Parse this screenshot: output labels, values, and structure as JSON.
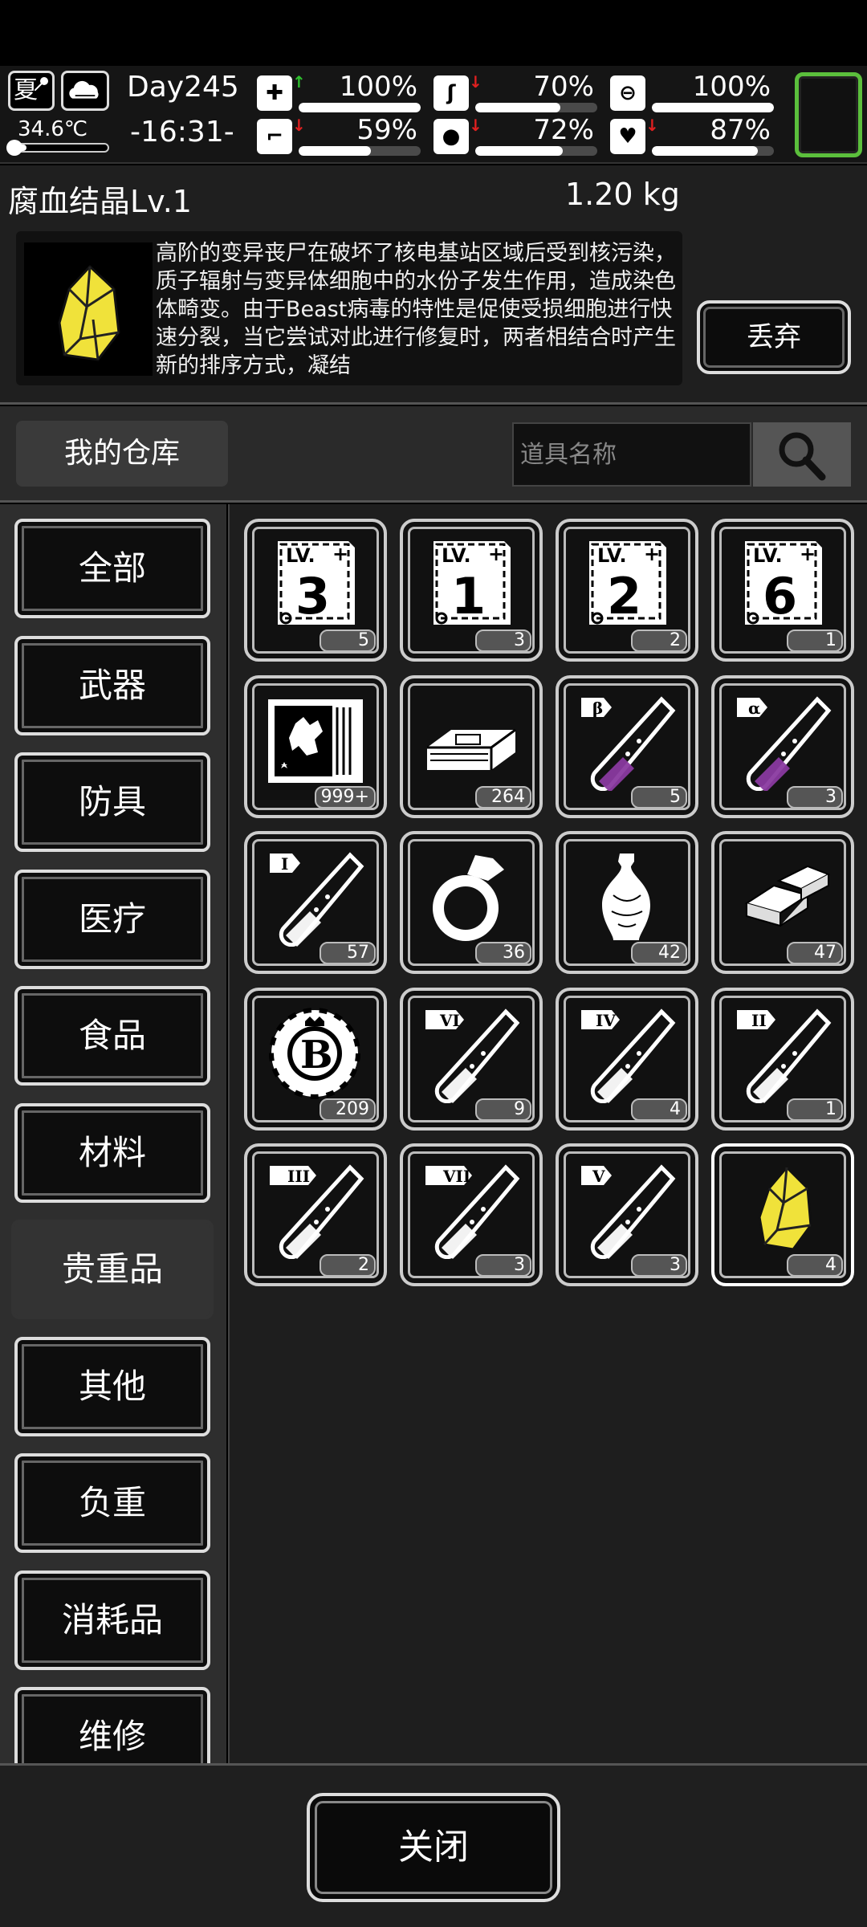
{
  "status": {
    "season": "夏",
    "temperature": "34.6℃",
    "day": "Day245",
    "time": "-16:31-",
    "stats": [
      {
        "id": "health",
        "icon": "medkit-icon",
        "arrow": "up",
        "value": "100%",
        "level": 1.0
      },
      {
        "id": "hunger",
        "icon": "stomach-icon",
        "arrow": "down",
        "value": "70%",
        "level": 0.7
      },
      {
        "id": "energy",
        "icon": "canteen-icon",
        "arrow": "none",
        "value": "100%",
        "level": 1.0
      },
      {
        "id": "stamina",
        "icon": "boot-icon",
        "arrow": "down",
        "value": "59%",
        "level": 0.59
      },
      {
        "id": "thirst",
        "icon": "water-drop-icon",
        "arrow": "down",
        "value": "72%",
        "level": 0.72
      },
      {
        "id": "mood",
        "icon": "heart-icon",
        "arrow": "down",
        "value": "87%",
        "level": 0.87
      }
    ],
    "accent_color": "#5bbf3c"
  },
  "detail": {
    "name": "腐血结晶Lv.1",
    "weight": "1.20 kg",
    "description": "高阶的变异丧尸在破坏了核电基站区域后受到核污染，质子辐射与变异体细胞中的水份子发生作用，造成染色体畸变。由于Beast病毒的特性是促使受损细胞进行快速分裂，当它尝试对此进行修复时，两者相结合时产生新的排序方式，凝结",
    "discard_label": "丢弃",
    "icon": "yellow-crystal-icon"
  },
  "search": {
    "warehouse_label": "我的仓库",
    "placeholder": "道具名称"
  },
  "categories": [
    "全部",
    "武器",
    "防具",
    "医疗",
    "食品",
    "材料",
    "贵重品",
    "其他",
    "负重",
    "消耗品",
    "维修"
  ],
  "active_category": "贵重品",
  "items": [
    {
      "icon": "blueprint-lv3-icon",
      "label": "3",
      "qty": "5"
    },
    {
      "icon": "blueprint-lv1-icon",
      "label": "1",
      "qty": "3"
    },
    {
      "icon": "blueprint-lv2-icon",
      "label": "2",
      "qty": "2"
    },
    {
      "icon": "blueprint-lv6-icon",
      "label": "6",
      "qty": "1"
    },
    {
      "icon": "mutant-research-card-icon",
      "label": "",
      "qty": "999+"
    },
    {
      "icon": "cash-bundle-icon",
      "label": "",
      "qty": "264"
    },
    {
      "icon": "beta-test-tube-icon",
      "label": "β",
      "qty": "5"
    },
    {
      "icon": "alpha-test-tube-icon",
      "label": "α",
      "qty": "3"
    },
    {
      "icon": "test-tube-i-icon",
      "label": "I",
      "qty": "57"
    },
    {
      "icon": "diamond-ring-icon",
      "label": "",
      "qty": "36"
    },
    {
      "icon": "porcelain-vase-icon",
      "label": "",
      "qty": "42"
    },
    {
      "icon": "gold-bars-icon",
      "label": "",
      "qty": "47"
    },
    {
      "icon": "bitcoin-chip-icon",
      "label": "B",
      "qty": "209"
    },
    {
      "icon": "test-tube-vi-icon",
      "label": "VI",
      "qty": "9"
    },
    {
      "icon": "test-tube-iv-icon",
      "label": "IV",
      "qty": "4"
    },
    {
      "icon": "test-tube-ii-icon",
      "label": "II",
      "qty": "1"
    },
    {
      "icon": "test-tube-iii-icon",
      "label": "III",
      "qty": "2"
    },
    {
      "icon": "test-tube-vii-icon",
      "label": "VII",
      "qty": "3"
    },
    {
      "icon": "test-tube-v-icon",
      "label": "V",
      "qty": "3"
    },
    {
      "icon": "yellow-crystal-icon",
      "label": "",
      "qty": "4"
    }
  ],
  "selected_item_index": 19,
  "close_label": "关闭"
}
